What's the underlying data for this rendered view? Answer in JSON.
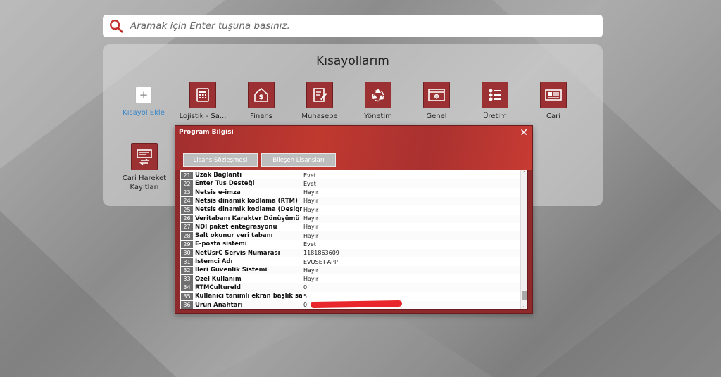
{
  "search": {
    "placeholder": "Aramak için Enter tuşuna basınız."
  },
  "panel": {
    "title": "Kısayollarım",
    "shortcuts": [
      {
        "label": "Kısayol Ekle",
        "icon": "plus-icon"
      },
      {
        "label": "Lojistik - Sa...",
        "icon": "cash-register-icon"
      },
      {
        "label": "Finans",
        "icon": "dollar-house-icon"
      },
      {
        "label": "Muhasebe",
        "icon": "document-edit-icon"
      },
      {
        "label": "Yönetim",
        "icon": "recycle-icon"
      },
      {
        "label": "Genel",
        "icon": "settings-window-icon"
      },
      {
        "label": "Üretim",
        "icon": "checklist-icon"
      },
      {
        "label": "Cari",
        "icon": "id-card-icon"
      },
      {
        "label": "Cari Hareket Kayıtları",
        "icon": "card-transfer-icon"
      }
    ]
  },
  "dialog": {
    "title": "Program Bilgisi",
    "close": "✕",
    "buttons": [
      "Lisans Sözleşmesi",
      "Bileşen Lisansları"
    ],
    "rows": [
      {
        "num": "21",
        "name": "Uzak Bağlantı",
        "value": "Evet"
      },
      {
        "num": "22",
        "name": "Enter Tuş Desteği",
        "value": "Evet"
      },
      {
        "num": "23",
        "name": "Netsis e-imza",
        "value": "Hayır"
      },
      {
        "num": "24",
        "name": "Netsis dinamik kodlama (RTM)",
        "value": "Hayır"
      },
      {
        "num": "25",
        "name": "Netsis dinamik kodlama (Design)",
        "value": "Hayır"
      },
      {
        "num": "26",
        "name": "Veritabanı Karakter Dönüşümü",
        "value": "Hayır"
      },
      {
        "num": "27",
        "name": "NDI paket entegrasyonu",
        "value": "Hayır"
      },
      {
        "num": "28",
        "name": "Salt okunur veri tabanı",
        "value": "Hayır"
      },
      {
        "num": "29",
        "name": "E-posta sistemi",
        "value": "Evet"
      },
      {
        "num": "30",
        "name": "NetUsrC Servis Numarası",
        "value": "1181863609"
      },
      {
        "num": "31",
        "name": "İstemci Adı",
        "value": "EVOSET-APP"
      },
      {
        "num": "32",
        "name": "İleri Güvenlik Sistemi",
        "value": "Hayır"
      },
      {
        "num": "33",
        "name": "Özel Kullanım",
        "value": "Hayır"
      },
      {
        "num": "34",
        "name": "RTMCultureId",
        "value": "0"
      },
      {
        "num": "35",
        "name": "Kullanıcı tanımlı ekran başlık sayısı",
        "value": "5"
      },
      {
        "num": "36",
        "name": "Ürün Anahtarı",
        "value": "0"
      }
    ],
    "scroll_up": "⌃",
    "scroll_down": "⌄"
  },
  "colors": {
    "accent": "#9b3132",
    "dialog_header": "#c0392f",
    "redaction": "#e8262b",
    "link": "#3a86c8"
  }
}
